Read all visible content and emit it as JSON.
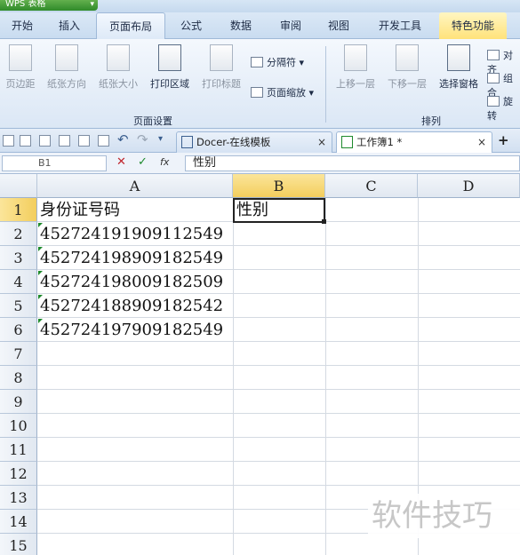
{
  "app": {
    "label": "WPS 表格",
    "dropdown_icon": "chevron-down-icon"
  },
  "menu_tabs": [
    "开始",
    "插入",
    "页面布局",
    "公式",
    "数据",
    "审阅",
    "视图",
    "开发工具",
    "特色功能"
  ],
  "active_tab": "页面布局",
  "ribbon": {
    "page_setup": {
      "buttons": [
        "页边距",
        "纸张方向",
        "纸张大小",
        "打印区域",
        "打印标题"
      ],
      "small": [
        "分隔符",
        "页面缩放"
      ],
      "label": "页面设置"
    },
    "arrange": {
      "buttons": [
        "上移一层",
        "下移一层",
        "选择窗格"
      ],
      "small": [
        "对齐",
        "组合",
        "旋转"
      ],
      "label": "排列"
    }
  },
  "doc_tabs": [
    {
      "label": "Docer-在线模板",
      "close": "×"
    },
    {
      "label": "工作簿1 *",
      "close": "×"
    }
  ],
  "new_tab_label": "+",
  "formula_bar": {
    "name_box": "B1",
    "cancel": "✕",
    "confirm": "✓",
    "fx": "fx",
    "value": "性别"
  },
  "grid": {
    "columns": [
      "A",
      "B",
      "C",
      "D"
    ],
    "rows": [
      "1",
      "2",
      "3",
      "4",
      "5",
      "6",
      "7",
      "8",
      "9",
      "10",
      "11",
      "12",
      "13",
      "14",
      "15"
    ],
    "selected_cell": "B1",
    "cells": {
      "A1": "身份证号码",
      "B1": "性别",
      "A2": "452724191909112549",
      "A3": "452724198909182549",
      "A4": "452724198009182509",
      "A5": "452724188909182542",
      "A6": "452724197909182549"
    }
  },
  "watermark": "软件技巧"
}
